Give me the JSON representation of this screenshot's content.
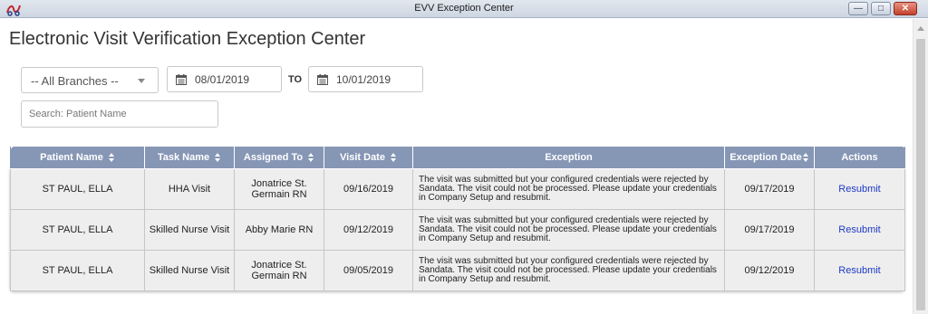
{
  "window": {
    "title": "EVV Exception Center",
    "app_icon": "app-logo-icon",
    "buttons": {
      "minimize": "minimize-icon",
      "maximize": "maximize-icon",
      "close": "close-icon"
    }
  },
  "page": {
    "title": "Electronic Visit Verification Exception Center"
  },
  "filters": {
    "branch": {
      "selected": "-- All Branches --",
      "icon": "chevron-down-icon"
    },
    "date_from": "08/01/2019",
    "to_label": "TO",
    "date_to": "10/01/2019",
    "calendar_icon": "calendar-icon",
    "search_placeholder": "Search: Patient Name",
    "search_value": ""
  },
  "table": {
    "columns": [
      {
        "label": "Patient Name",
        "sortable": true
      },
      {
        "label": "Task Name",
        "sortable": true
      },
      {
        "label": "Assigned To",
        "sortable": true
      },
      {
        "label": "Visit Date",
        "sortable": true
      },
      {
        "label": "Exception",
        "sortable": false
      },
      {
        "label": "Exception Date",
        "sortable": true
      },
      {
        "label": "Actions",
        "sortable": false
      }
    ],
    "rows": [
      {
        "patient": "ST PAUL, ELLA",
        "task": "HHA Visit",
        "assigned": "Jonatrice St. Germain RN",
        "visit_date": "09/16/2019",
        "exception": "The visit was submitted but your configured credentials were rejected by Sandata. The visit could not be processed. Please update your credentials in Company Setup and resubmit.",
        "exception_date": "09/17/2019",
        "action": "Resubmit"
      },
      {
        "patient": "ST PAUL, ELLA",
        "task": "Skilled Nurse Visit",
        "assigned": "Abby Marie RN",
        "visit_date": "09/12/2019",
        "exception": "The visit was submitted but your configured credentials were rejected by Sandata. The visit could not be processed. Please update your credentials in Company Setup and resubmit.",
        "exception_date": "09/17/2019",
        "action": "Resubmit"
      },
      {
        "patient": "ST PAUL, ELLA",
        "task": "Skilled Nurse Visit",
        "assigned": "Jonatrice St. Germain RN",
        "visit_date": "09/05/2019",
        "exception": "The visit was submitted but your configured credentials were rejected by Sandata. The visit could not be processed. Please update your credentials in Company Setup and resubmit.",
        "exception_date": "09/12/2019",
        "action": "Resubmit"
      }
    ]
  },
  "colors": {
    "header_bg": "#8696b5",
    "row_bg": "#eeeeee",
    "link": "#1e39c4"
  }
}
